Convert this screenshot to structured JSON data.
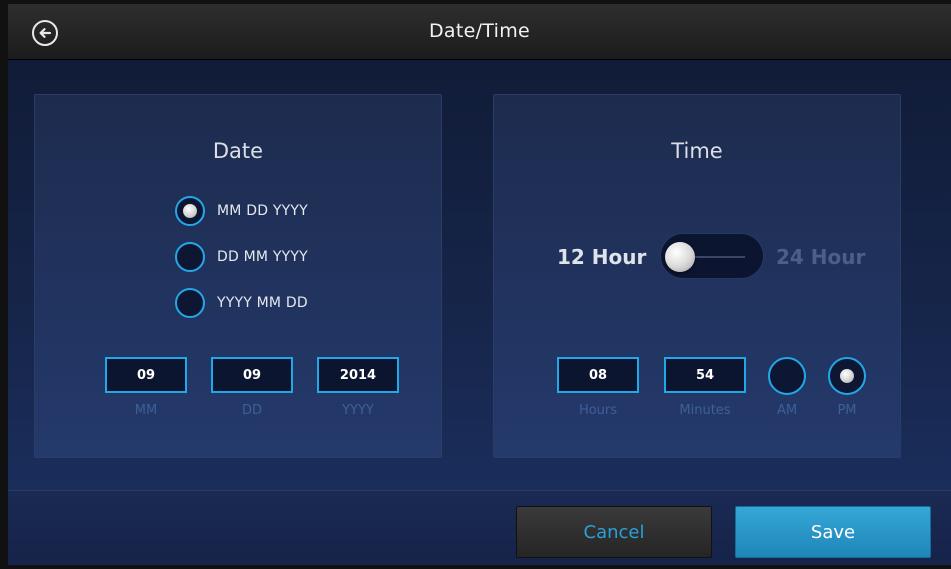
{
  "header": {
    "title": "Date/Time",
    "back_icon": "back-arrow-circle-icon"
  },
  "date_panel": {
    "title": "Date",
    "formats": [
      {
        "label": "MM DD YYYY",
        "selected": true
      },
      {
        "label": "DD MM YYYY",
        "selected": false
      },
      {
        "label": "YYYY MM DD",
        "selected": false
      }
    ],
    "fields": [
      {
        "value": "09",
        "label": "MM"
      },
      {
        "value": "09",
        "label": "DD"
      },
      {
        "value": "2014",
        "label": "YYYY"
      }
    ]
  },
  "time_panel": {
    "title": "Time",
    "toggle_left_label": "12 Hour",
    "toggle_right_label": "24 Hour",
    "toggle_value": "12 Hour",
    "fields": [
      {
        "value": "08",
        "label": "Hours"
      },
      {
        "value": "54",
        "label": "Minutes"
      }
    ],
    "am_label": "AM",
    "pm_label": "PM",
    "meridiem_selected": "PM"
  },
  "footer": {
    "cancel_label": "Cancel",
    "save_label": "Save"
  },
  "colors": {
    "accent": "#22a8e8",
    "save_button": "#2a97c8",
    "toggle_active_label": "#dfe3ea",
    "toggle_inactive_label": "#4d5f86"
  }
}
